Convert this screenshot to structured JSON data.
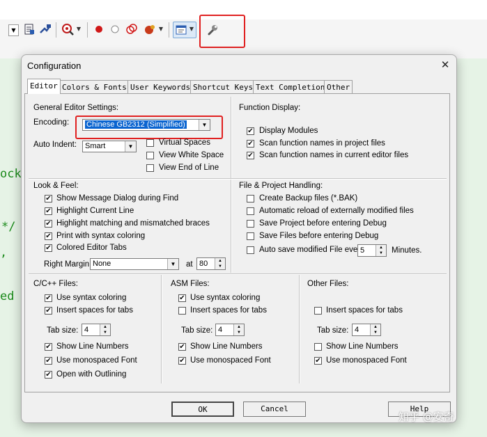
{
  "code": {
    "line1": "ock",
    "line2": "*/",
    "line3": ",",
    "line4": "ed p"
  },
  "toolbar": {
    "icons": [
      "dropdown-arrow",
      "insert-template-icon",
      "configure-flash-icon",
      "find-icon",
      "breakpoint-icon",
      "disable-breakpoint-icon",
      "kill-breakpoints-icon",
      "debug-session-icon",
      "window-layout-icon",
      "configuration-wrench-icon"
    ]
  },
  "dialog": {
    "title": "Configuration",
    "tabs": [
      "Editor",
      "Colors & Fonts",
      "User Keywords",
      "Shortcut Keys",
      "Text Completion",
      "Other"
    ],
    "general": {
      "heading": "General Editor Settings:",
      "encoding_label": "Encoding:",
      "encoding_value": "Chinese GB2312 (Simplified)",
      "auto_indent_label": "Auto Indent:",
      "auto_indent_value": "Smart",
      "virtual_spaces": "Virtual Spaces",
      "view_white_space": "View White Space",
      "view_end_of_line": "View End of Line"
    },
    "function_display": {
      "heading": "Function Display:",
      "display_modules": "Display Modules",
      "scan_project": "Scan function names in project files",
      "scan_editor": "Scan function names in current editor files"
    },
    "look_feel": {
      "heading": "Look & Feel:",
      "show_message": "Show Message Dialog during Find",
      "highlight_line": "Highlight Current Line",
      "highlight_braces": "Highlight matching and mismatched braces",
      "print_syntax": "Print with syntax coloring",
      "colored_tabs": "Colored Editor Tabs",
      "right_margin_label": "Right Margin:",
      "right_margin_value": "None",
      "at_label": "at",
      "at_value": "80"
    },
    "file_project": {
      "heading": "File & Project Handling:",
      "create_backup": "Create Backup files (*.BAK)",
      "auto_reload": "Automatic reload of externally modified files",
      "save_project": "Save Project before entering Debug",
      "save_files": "Save Files before entering Debug",
      "auto_save": "Auto save modified File every",
      "auto_save_value": "5",
      "minutes": "Minutes."
    },
    "c_files": {
      "heading": "C/C++ Files:",
      "syntax": "Use syntax coloring",
      "spaces": "Insert spaces for tabs",
      "tab_size_label": "Tab size:",
      "tab_size": "4",
      "line_numbers": "Show Line Numbers",
      "monospaced": "Use monospaced Font",
      "outlining": "Open with Outlining"
    },
    "asm_files": {
      "heading": "ASM Files:",
      "syntax": "Use syntax coloring",
      "spaces": "Insert spaces for tabs",
      "tab_size_label": "Tab size:",
      "tab_size": "4",
      "line_numbers": "Show Line Numbers",
      "monospaced": "Use monospaced Font"
    },
    "other_files": {
      "heading": "Other Files:",
      "spaces": "Insert spaces for tabs",
      "tab_size_label": "Tab size:",
      "tab_size": "4",
      "line_numbers": "Show Line Numbers",
      "monospaced": "Use monospaced Font"
    },
    "buttons": {
      "ok": "OK",
      "cancel": "Cancel",
      "help": "Help"
    }
  },
  "watermark": "知乎 @安奇",
  "colors": {
    "highlight_box": "#e02020",
    "code_green": "#1b8a1b",
    "editor_bg": "#e6f3e6",
    "selection": "#0a64d0"
  }
}
